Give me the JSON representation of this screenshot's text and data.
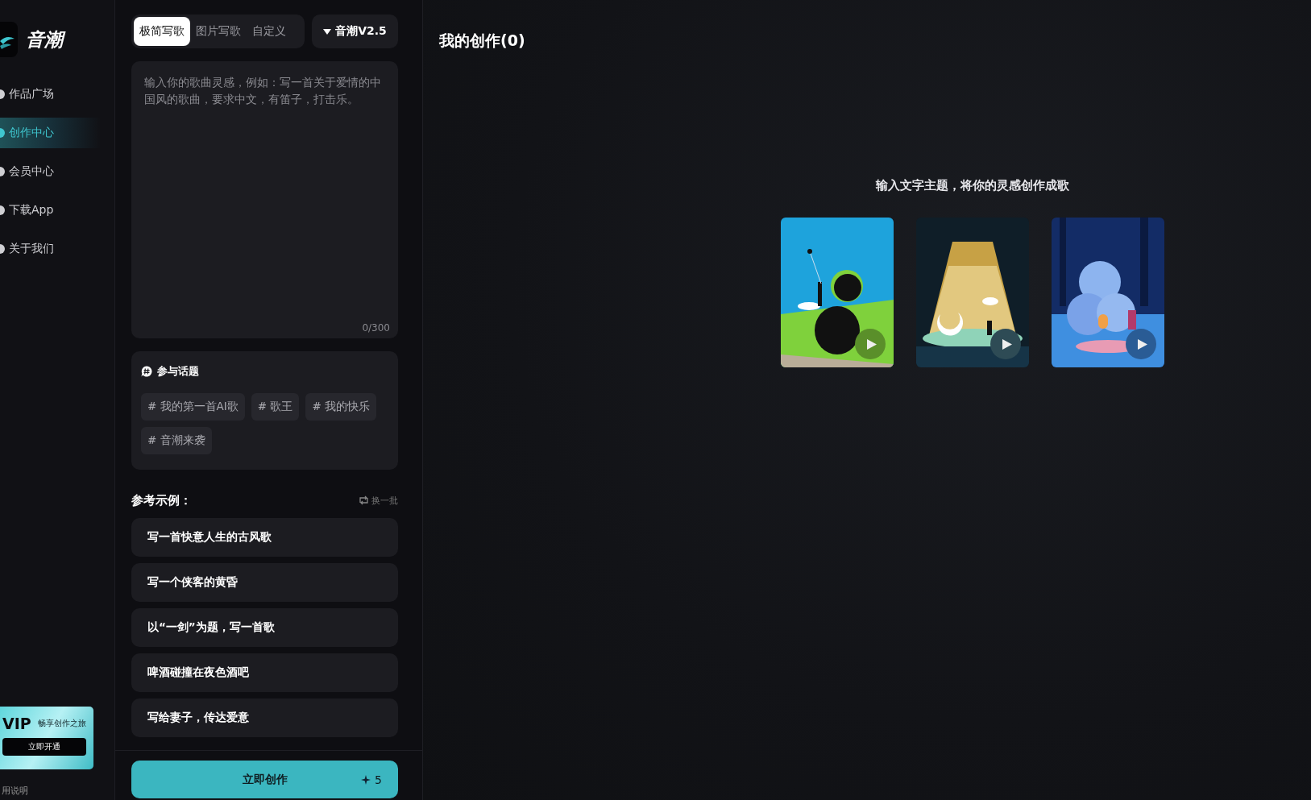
{
  "sidebar": {
    "logo_text": "音潮",
    "items": [
      {
        "label": "作品广场",
        "selected": false
      },
      {
        "label": "创作中心",
        "selected": true
      },
      {
        "label": "会员中心",
        "selected": false
      },
      {
        "label": "下载App",
        "selected": false
      },
      {
        "label": "关于我们",
        "selected": false
      }
    ],
    "vip_card": {
      "badge": "VIP",
      "tagline": "畅享创作之旅",
      "button": "立即开通"
    },
    "footer_link": "用说明"
  },
  "composer": {
    "tabs": [
      {
        "label": "极简写歌",
        "selected": true
      },
      {
        "label": "图片写歌",
        "selected": false
      },
      {
        "label": "自定义",
        "selected": false
      }
    ],
    "model_button": "音潮V2.5",
    "prompt": {
      "placeholder": "输入你的歌曲灵感，例如：写一首关于爱情的中国风的歌曲，要求中文，有笛子，打击乐。",
      "counter": "0/300"
    },
    "topics": {
      "title": "参与话题",
      "tags": [
        "# 我的第一首AI歌",
        "# 歌王",
        "# 我的快乐",
        "# 音潮来袭"
      ]
    },
    "examples": {
      "title": "参考示例：",
      "refresh": "换一批",
      "items": [
        "写一首快意人生的古风歌",
        "写一个侠客的黄昏",
        "以“一剑”为题，写一首歌",
        "啤酒碰撞在夜色酒吧",
        "写给妻子，传达爱意"
      ]
    },
    "create_button": {
      "label": "立即创作",
      "cost": "5"
    }
  },
  "main": {
    "title": "我的创作(0)",
    "empty_hint": "输入文字主题，将你的灵感创作成歌"
  }
}
